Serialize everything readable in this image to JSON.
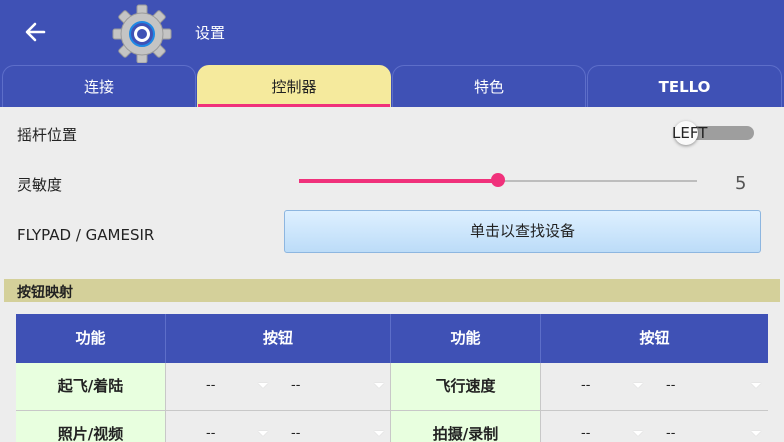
{
  "header": {
    "title": "设置"
  },
  "tabs": [
    {
      "label": "连接"
    },
    {
      "label": "控制器"
    },
    {
      "label": "特色"
    },
    {
      "label": "TELLO"
    }
  ],
  "settings": {
    "joystick_label": "摇杆位置",
    "joystick_value": "LEFT",
    "sensitivity_label": "灵敏度",
    "sensitivity_value": "5",
    "sensitivity_fraction": 0.5,
    "gamepad_label": "FLYPAD / GAMESIR",
    "find_device_label": "单击以查找设备"
  },
  "mapping": {
    "title": "按钮映射",
    "headers": [
      "功能",
      "按钮",
      "功能",
      "按钮"
    ],
    "rows": [
      {
        "func_left": "起飞/着陆",
        "left_a": "--",
        "left_b": "--",
        "func_right": "飞行速度",
        "right_a": "--",
        "right_b": "--"
      },
      {
        "func_left": "照片/视频",
        "left_a": "--",
        "left_b": "--",
        "func_right": "拍摄/录制",
        "right_a": "--",
        "right_b": "--"
      }
    ]
  },
  "colors": {
    "primary": "#3f51b5",
    "accent": "#f0317b",
    "active_tab": "#f5ea9d",
    "section": "#d4d09a",
    "function_cell": "#e8ffdf"
  }
}
